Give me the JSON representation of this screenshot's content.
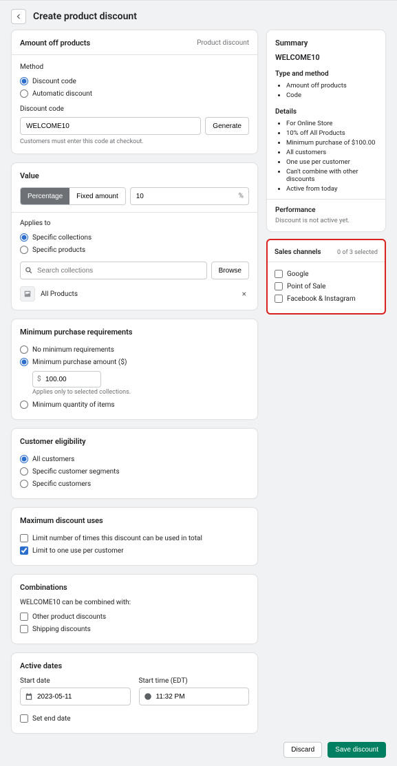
{
  "header": {
    "title": "Create product discount"
  },
  "amount_card": {
    "title": "Amount off products",
    "badge": "Product discount",
    "method_label": "Method",
    "method_options": {
      "code": "Discount code",
      "auto": "Automatic discount"
    },
    "code_label": "Discount code",
    "code_value": "WELCOME10",
    "generate": "Generate",
    "code_help": "Customers must enter this code at checkout."
  },
  "value_card": {
    "title": "Value",
    "percentage": "Percentage",
    "fixed": "Fixed amount",
    "value": "10",
    "suffix": "%",
    "applies_label": "Applies to",
    "opt_collections": "Specific collections",
    "opt_products": "Specific products",
    "search_placeholder": "Search collections",
    "browse": "Browse",
    "tag": "All Products"
  },
  "min_card": {
    "title": "Minimum purchase requirements",
    "none": "No minimum requirements",
    "amount": "Minimum purchase amount ($)",
    "amount_value": "100.00",
    "amount_help": "Applies only to selected collections.",
    "qty": "Minimum quantity of items"
  },
  "elig_card": {
    "title": "Customer eligibility",
    "all": "All customers",
    "segments": "Specific customer segments",
    "specific": "Specific customers"
  },
  "max_card": {
    "title": "Maximum discount uses",
    "total": "Limit number of times this discount can be used in total",
    "one": "Limit to one use per customer"
  },
  "combo_card": {
    "title": "Combinations",
    "text_prefix": "WELCOME10",
    "text_suffix": " can be combined with:",
    "product": "Other product discounts",
    "shipping": "Shipping discounts"
  },
  "dates_card": {
    "title": "Active dates",
    "start_date_label": "Start date",
    "start_date": "2023-05-11",
    "start_time_label": "Start time (EDT)",
    "start_time": "11:32 PM",
    "set_end": "Set end date"
  },
  "summary": {
    "title": "Summary",
    "name": "WELCOME10",
    "type_h": "Type and method",
    "type_items": [
      "Amount off products",
      "Code"
    ],
    "details_h": "Details",
    "details_items": [
      "For Online Store",
      "10% off All Products",
      "Minimum purchase of $100.00",
      "All customers",
      "One use per customer",
      "Can't combine with other discounts",
      "Active from today"
    ],
    "perf_h": "Performance",
    "perf_text": "Discount is not active yet."
  },
  "sales": {
    "title": "Sales channels",
    "count": "0 of 3 selected",
    "items": [
      "Google",
      "Point of Sale",
      "Facebook & Instagram"
    ]
  },
  "footer": {
    "discard": "Discard",
    "save": "Save discount"
  }
}
